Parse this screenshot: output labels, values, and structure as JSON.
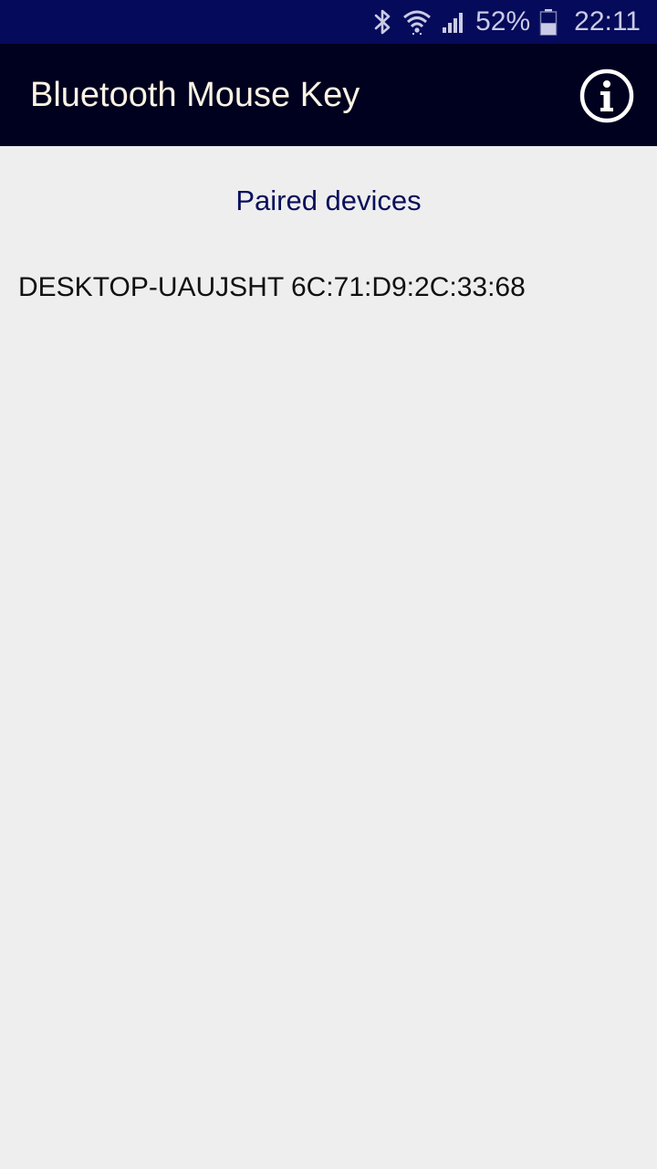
{
  "status_bar": {
    "icons": [
      "bluetooth-icon",
      "wifi-icon",
      "signal-icon",
      "battery-icon"
    ],
    "battery_percent": "52%",
    "battery_level": 0.52,
    "time": "22:11",
    "background_color": "#050a5a"
  },
  "app_bar": {
    "title": "Bluetooth Mouse Key",
    "info_icon": "info-icon",
    "background_color": "#00001f"
  },
  "paired": {
    "title": "Paired devices",
    "devices": [
      {
        "label": "DESKTOP-UAUJSHT 6C:71:D9:2C:33:68"
      }
    ]
  }
}
